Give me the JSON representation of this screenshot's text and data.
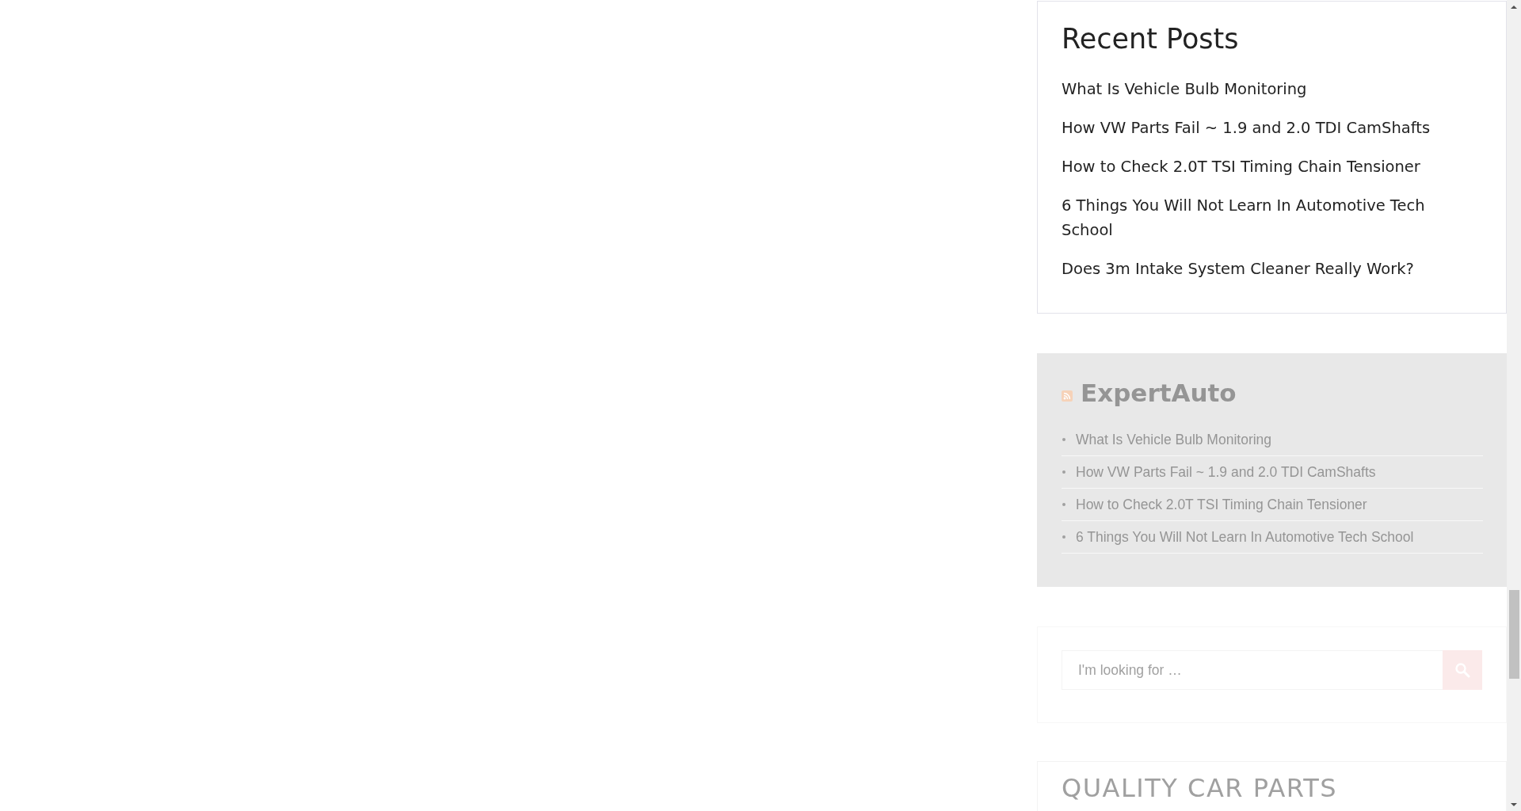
{
  "recent_posts": {
    "title": "Recent Posts",
    "items": [
      "What Is Vehicle Bulb Monitoring",
      "How VW Parts Fail ~ 1.9 and 2.0 TDI CamShafts",
      "How to Check 2.0T TSI Timing Chain Tensioner",
      "6 Things You Will Not Learn In Automotive Tech School",
      "Does 3m Intake System Cleaner Really Work?"
    ]
  },
  "rss_widget": {
    "title": "ExpertAuto",
    "items": [
      "What Is Vehicle Bulb Monitoring",
      "How VW Parts Fail ~ 1.9 and 2.0 TDI CamShafts",
      "How to Check 2.0T TSI Timing Chain Tensioner",
      "6 Things You Will Not Learn In Automotive Tech School"
    ]
  },
  "search": {
    "placeholder": "I'm looking for …"
  },
  "quality_widget": {
    "title": "QUALITY CAR PARTS"
  }
}
